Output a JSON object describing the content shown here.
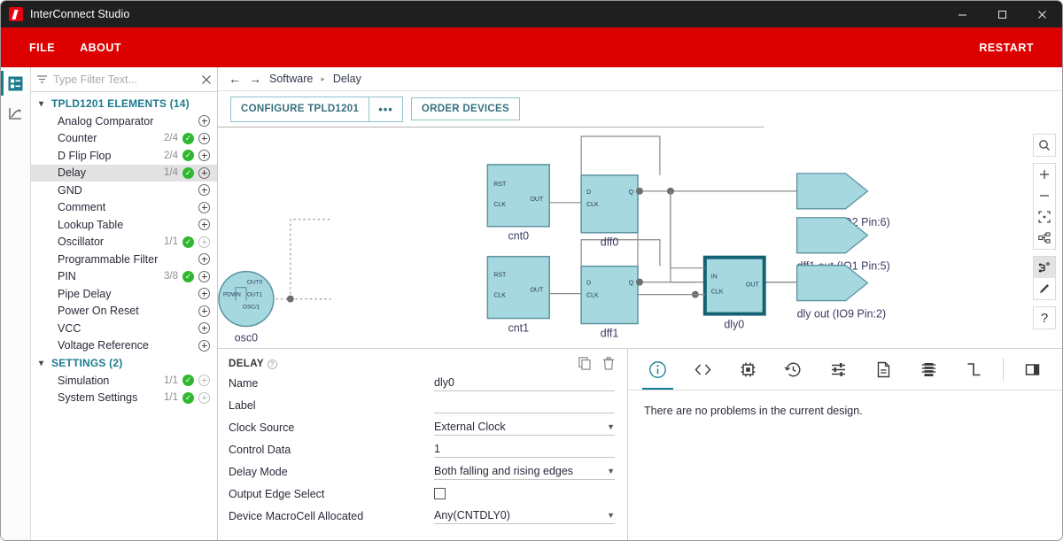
{
  "window": {
    "title": "InterConnect Studio",
    "logo_icon": "app-logo-icon",
    "minimize": "–",
    "maximize": "☐",
    "close": "✕"
  },
  "menubar": {
    "items": [
      {
        "label": "FILE",
        "name": "menu-file"
      },
      {
        "label": "ABOUT",
        "name": "menu-about"
      }
    ],
    "restart_label": "RESTART"
  },
  "rail": {
    "items": [
      {
        "name": "components-view-icon",
        "active": true
      },
      {
        "name": "waveform-view-icon",
        "active": false
      }
    ]
  },
  "filter": {
    "placeholder": "Type Filter Text...",
    "value": "",
    "filter_icon": "filter-icon",
    "clear_icon": "clear-icon"
  },
  "tree": {
    "groups": [
      {
        "label": "TPLD1201 ELEMENTS (14)",
        "name": "tree-group-tpld1201-elements",
        "items": [
          {
            "label": "Analog Comparator",
            "count": "",
            "check": false,
            "add": true,
            "selected": false
          },
          {
            "label": "Counter",
            "count": "2/4",
            "check": true,
            "add": true,
            "selected": false
          },
          {
            "label": "D Flip Flop",
            "count": "2/4",
            "check": true,
            "add": true,
            "selected": false
          },
          {
            "label": "Delay",
            "count": "1/4",
            "check": true,
            "add": true,
            "selected": true
          },
          {
            "label": "GND",
            "count": "",
            "check": false,
            "add": true,
            "selected": false
          },
          {
            "label": "Comment",
            "count": "",
            "check": false,
            "add": true,
            "selected": false
          },
          {
            "label": "Lookup Table",
            "count": "",
            "check": false,
            "add": true,
            "selected": false
          },
          {
            "label": "Oscillator",
            "count": "1/1",
            "check": true,
            "add": false,
            "selected": false
          },
          {
            "label": "Programmable Filter",
            "count": "",
            "check": false,
            "add": true,
            "selected": false
          },
          {
            "label": "PIN",
            "count": "3/8",
            "check": true,
            "add": true,
            "selected": false
          },
          {
            "label": "Pipe Delay",
            "count": "",
            "check": false,
            "add": true,
            "selected": false
          },
          {
            "label": "Power On Reset",
            "count": "",
            "check": false,
            "add": true,
            "selected": false
          },
          {
            "label": "VCC",
            "count": "",
            "check": false,
            "add": true,
            "selected": false
          },
          {
            "label": "Voltage Reference",
            "count": "",
            "check": false,
            "add": true,
            "selected": false
          }
        ]
      },
      {
        "label": "SETTINGS (2)",
        "name": "tree-group-settings",
        "items": [
          {
            "label": "Simulation",
            "count": "1/1",
            "check": true,
            "add": false,
            "selected": false
          },
          {
            "label": "System Settings",
            "count": "1/1",
            "check": true,
            "add": false,
            "selected": false
          }
        ]
      }
    ]
  },
  "breadcrumb": {
    "back_icon": "back-arrow-icon",
    "forward_icon": "forward-arrow-icon",
    "parts": [
      "Software",
      "Delay"
    ],
    "separator": "▸"
  },
  "toolbar": {
    "configure_label": "CONFIGURE TPLD1201",
    "more_label": "•••",
    "order_label": "ORDER DEVICES"
  },
  "canvas_tools": {
    "groups": [
      [
        {
          "name": "search-icon",
          "glyph": "search",
          "active": false
        }
      ],
      [
        {
          "name": "zoom-in-icon",
          "glyph": "plus",
          "active": false
        },
        {
          "name": "zoom-out-icon",
          "glyph": "minus",
          "active": false
        },
        {
          "name": "zoom-fit-icon",
          "glyph": "fit",
          "active": false
        },
        {
          "name": "layout-tree-icon",
          "glyph": "layout",
          "active": false
        }
      ],
      [
        {
          "name": "route-wire-icon",
          "glyph": "route",
          "active": true
        },
        {
          "name": "pen-tool-icon",
          "glyph": "pen",
          "active": false
        }
      ],
      [
        {
          "name": "help-icon",
          "glyph": "question",
          "active": false
        }
      ]
    ]
  },
  "schematic": {
    "blocks": [
      {
        "name": "cnt0",
        "label": "cnt0",
        "ports_left": [
          "RST",
          "CLK"
        ],
        "ports_right": [
          "OUT"
        ],
        "selected": false
      },
      {
        "name": "dff0",
        "label": "dff0",
        "ports_left": [
          "D",
          "CLK"
        ],
        "ports_right": [
          "Q"
        ],
        "selected": false
      },
      {
        "name": "cnt1",
        "label": "cnt1",
        "ports_left": [
          "RST",
          "CLK"
        ],
        "ports_right": [
          "OUT"
        ],
        "selected": false
      },
      {
        "name": "dff1",
        "label": "dff1",
        "ports_left": [
          "D",
          "CLK"
        ],
        "ports_right": [
          "Q"
        ],
        "selected": false
      },
      {
        "name": "dly0",
        "label": "dly0",
        "ports_left": [
          "IN",
          "CLK"
        ],
        "ports_right": [
          "OUT"
        ],
        "selected": true
      }
    ],
    "oscillator": {
      "name": "osc0",
      "label": "osc0",
      "ports": [
        "PDWN",
        "OUT0",
        "OUT1",
        "OSC/1"
      ]
    },
    "outputs": [
      {
        "name": "dff0-out-pin",
        "label": "dff0 out (IO2 Pin:6)"
      },
      {
        "name": "dff1-out-pin",
        "label": "dff1 out (IO1 Pin:5)"
      },
      {
        "name": "dly-out-pin",
        "label": "dly out (IO9 Pin:2)"
      }
    ],
    "colors": {
      "block_fill": "#a6d8e0",
      "block_stroke": "#5b93a0",
      "selected_stroke": "#116374",
      "wire": "#8a8a8a",
      "label_text": "#3b3b63"
    }
  },
  "properties": {
    "title": "DELAY",
    "help_icon": "help-circle-icon",
    "copy_icon": "copy-icon",
    "delete_icon": "delete-icon",
    "fields": [
      {
        "label": "Name",
        "value": "dly0",
        "type": "text",
        "name": "name-field"
      },
      {
        "label": "Label",
        "value": "",
        "type": "text",
        "name": "label-field"
      },
      {
        "label": "Clock Source",
        "value": "External Clock",
        "type": "select",
        "name": "clock-source-select"
      },
      {
        "label": "Control Data",
        "value": "1",
        "type": "text",
        "name": "control-data-field"
      },
      {
        "label": "Delay Mode",
        "value": "Both falling and rising edges",
        "type": "select",
        "name": "delay-mode-select"
      },
      {
        "label": "Output Edge Select",
        "value": "",
        "type": "checkbox",
        "name": "output-edge-select-checkbox"
      },
      {
        "label": "Device MacroCell Allocated",
        "value": "Any(CNTDLY0)",
        "type": "select-short",
        "name": "device-macrocell-select"
      }
    ]
  },
  "info_panel": {
    "tabs": [
      {
        "name": "tab-info",
        "glyph": "info",
        "active": true
      },
      {
        "name": "tab-code",
        "glyph": "code",
        "active": false
      },
      {
        "name": "tab-chip",
        "glyph": "chip",
        "active": false
      },
      {
        "name": "tab-history",
        "glyph": "history",
        "active": false
      },
      {
        "name": "tab-settings",
        "glyph": "sliders",
        "active": false
      },
      {
        "name": "tab-document",
        "glyph": "document",
        "active": false
      },
      {
        "name": "tab-ic",
        "glyph": "ic",
        "active": false
      },
      {
        "name": "tab-waveform",
        "glyph": "waveform",
        "active": false
      },
      {
        "name": "tab-panel-toggle",
        "glyph": "panel",
        "active": false,
        "after_divider": true
      }
    ],
    "message": "There are no problems in the current design."
  }
}
